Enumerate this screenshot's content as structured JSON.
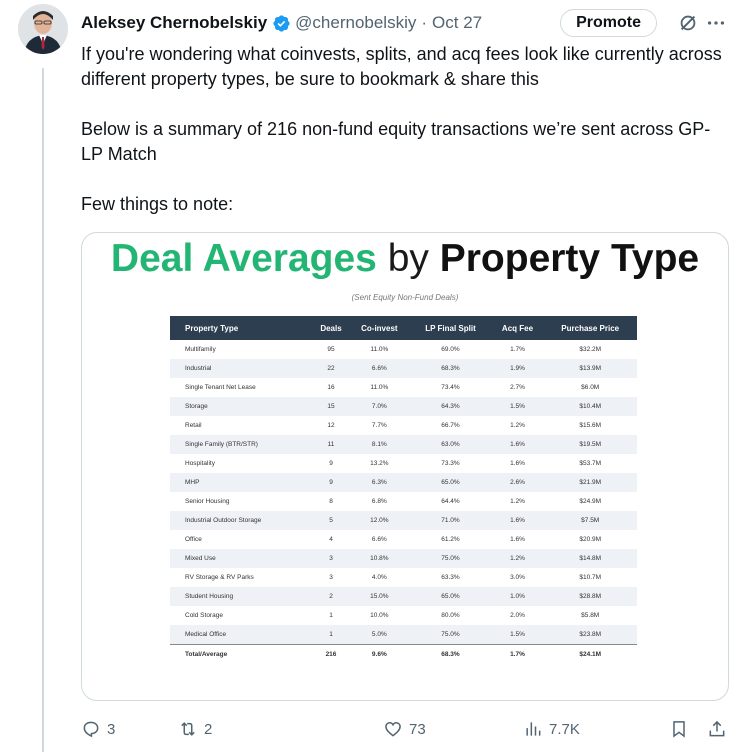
{
  "author": {
    "name": "Aleksey Chernobelskiy",
    "handle": "@chernobelskiy",
    "separator": "·",
    "time": "Oct 27",
    "verified_color": "#1d9bf0"
  },
  "header": {
    "promote_label": "Promote"
  },
  "tweet": {
    "paragraphs": [
      "If you're wondering what coinvests, splits, and acq fees look like currently across different property types, be sure to bookmark & share this",
      "Below is a summary of 216 non-fund equity transactions we’re sent across GP-LP Match",
      "Few things to note:"
    ]
  },
  "card": {
    "title_part1": "Deal Averages",
    "title_part2": "by",
    "title_part3": "Property Type",
    "subtitle": "(Sent Equity Non-Fund Deals)",
    "accent_color": "#22b573",
    "header_color": "#2d3e50",
    "columns": [
      "Property Type",
      "Deals",
      "Co-invest",
      "LP Final Split",
      "Acq Fee",
      "Purchase Price"
    ],
    "rows": [
      [
        "Multifamily",
        "95",
        "11.0%",
        "69.0%",
        "1.7%",
        "$32.2M"
      ],
      [
        "Industrial",
        "22",
        "6.6%",
        "68.3%",
        "1.9%",
        "$13.9M"
      ],
      [
        "Single Tenant Net Lease",
        "16",
        "11.0%",
        "73.4%",
        "2.7%",
        "$6.0M"
      ],
      [
        "Storage",
        "15",
        "7.0%",
        "64.3%",
        "1.5%",
        "$10.4M"
      ],
      [
        "Retail",
        "12",
        "7.7%",
        "66.7%",
        "1.2%",
        "$15.6M"
      ],
      [
        "Single Family (BTR/STR)",
        "11",
        "8.1%",
        "63.0%",
        "1.6%",
        "$19.5M"
      ],
      [
        "Hospitality",
        "9",
        "13.2%",
        "73.3%",
        "1.6%",
        "$53.7M"
      ],
      [
        "MHP",
        "9",
        "6.3%",
        "65.0%",
        "2.6%",
        "$21.9M"
      ],
      [
        "Senior Housing",
        "8",
        "6.8%",
        "64.4%",
        "1.2%",
        "$24.9M"
      ],
      [
        "Industrial Outdoor Storage",
        "5",
        "12.0%",
        "71.0%",
        "1.6%",
        "$7.5M"
      ],
      [
        "Office",
        "4",
        "6.6%",
        "61.2%",
        "1.6%",
        "$20.9M"
      ],
      [
        "Mixed Use",
        "3",
        "10.8%",
        "75.0%",
        "1.2%",
        "$14.8M"
      ],
      [
        "RV Storage & RV Parks",
        "3",
        "4.0%",
        "63.3%",
        "3.0%",
        "$10.7M"
      ],
      [
        "Student Housing",
        "2",
        "15.0%",
        "65.0%",
        "1.0%",
        "$28.8M"
      ],
      [
        "Cold Storage",
        "1",
        "10.0%",
        "80.0%",
        "2.0%",
        "$5.8M"
      ],
      [
        "Medical Office",
        "1",
        "5.0%",
        "75.0%",
        "1.5%",
        "$23.8M"
      ]
    ],
    "total": [
      "Total/Average",
      "216",
      "9.6%",
      "68.3%",
      "1.7%",
      "$24.1M"
    ]
  },
  "actions": {
    "replies": "3",
    "reposts": "2",
    "likes": "73",
    "views": "7.7K"
  },
  "icons": {
    "reply": "reply-icon",
    "repost": "repost-icon",
    "like": "heart-icon",
    "views": "views-icon",
    "bookmark": "bookmark-icon",
    "share": "share-icon",
    "grok": "grok-icon",
    "more": "more-icon",
    "verified": "verified-badge-icon"
  }
}
